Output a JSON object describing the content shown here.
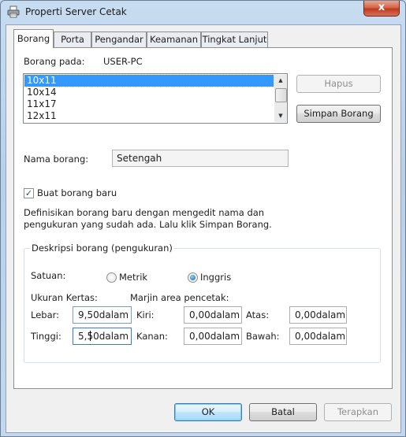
{
  "window": {
    "title": "Properti Server Cetak",
    "close_label": "x"
  },
  "tabs": [
    {
      "label": "Borang",
      "active": true
    },
    {
      "label": "Porta",
      "active": false
    },
    {
      "label": "Pengandar",
      "active": false
    },
    {
      "label": "Keamanan",
      "active": false
    },
    {
      "label": "Tingkat Lanjut",
      "active": false
    }
  ],
  "forms": {
    "forms_on_label": "Borang pada:",
    "server_name": "USER-PC",
    "list_items": [
      "10x11",
      "10x14",
      "11x17",
      "12x11"
    ],
    "selected_item": "10x11",
    "delete_button": "Hapus",
    "save_button": "Simpan Borang",
    "form_name_label": "Nama borang:",
    "form_name_value": "Setengah",
    "create_new_label": "Buat borang baru",
    "create_new_checked": true,
    "description_line1": "Definisikan borang baru dengan mengedit nama dan",
    "description_line2": "pengukuran yang sudah ada. Lalu klik Simpan Borang."
  },
  "measurements": {
    "group_title": "Deskripsi borang (pengukuran)",
    "units_label": "Satuan:",
    "unit_metric": "Metrik",
    "unit_english": "Inggris",
    "selected_unit": "Inggris",
    "paper_size_label": "Ukuran Kertas:",
    "margins_label": "Marjin area pencetak:",
    "width_label": "Lebar:",
    "width_value": "9,50dalam",
    "height_label": "Tinggi:",
    "height_value": "5,50dalam",
    "left_label": "Kiri:",
    "left_value": "0,00dalam",
    "right_label": "Kanan:",
    "right_value": "0,00dalam",
    "top_label": "Atas:",
    "top_value": "0,00dalam",
    "bottom_label": "Bawah:",
    "bottom_value": "0,00dalam"
  },
  "footer": {
    "ok": "OK",
    "cancel": "Batal",
    "apply": "Terapkan"
  },
  "colors": {
    "selection": "#3399ff",
    "close_button": "#c0391f",
    "frame": "#c4d7ee"
  }
}
